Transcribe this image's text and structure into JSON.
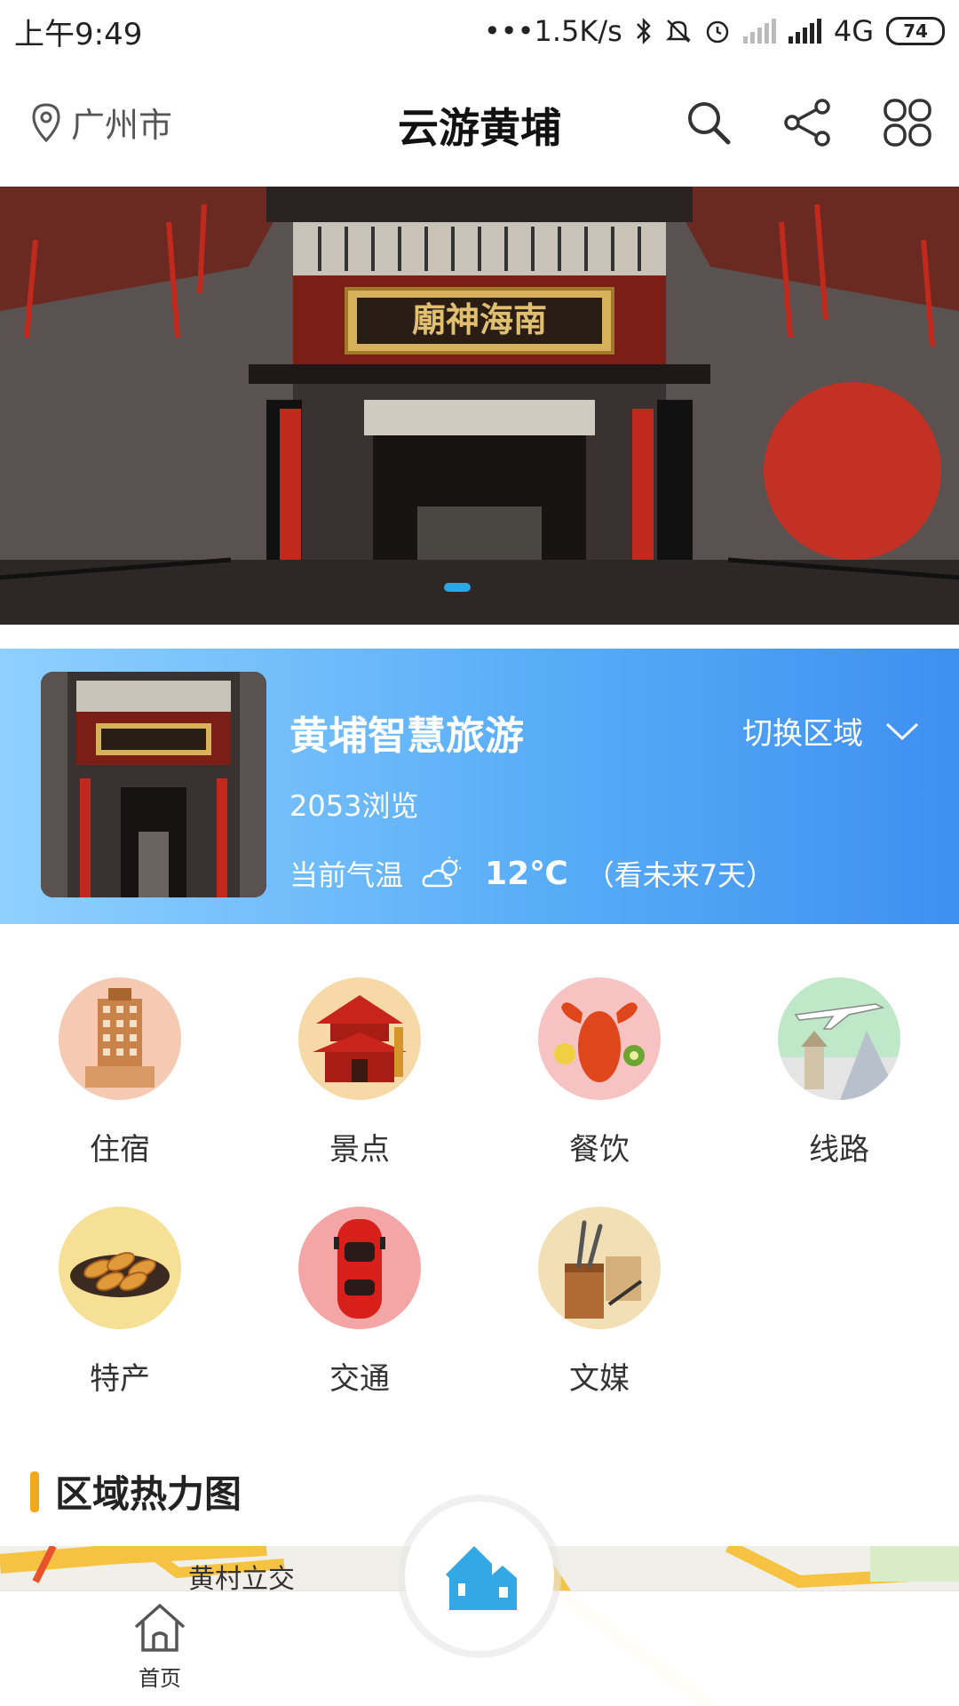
{
  "status_bar": {
    "time": "上午9:49",
    "speed": "•••1.5K/s",
    "network": "4G",
    "battery": "74"
  },
  "header": {
    "location": "广州市",
    "title": "云游黄埔"
  },
  "banner": {
    "sign_text": "廟神海南"
  },
  "info_card": {
    "name": "黄埔智慧旅游",
    "switch_label": "切换区域",
    "views": "2053浏览",
    "temp_label": "当前气温",
    "temperature": "12℃",
    "forecast": "（看未来7天）"
  },
  "categories": [
    {
      "label": "住宿",
      "icon": "hotel-building-icon"
    },
    {
      "label": "景点",
      "icon": "pagoda-temple-icon"
    },
    {
      "label": "餐饮",
      "icon": "lobster-food-icon"
    },
    {
      "label": "线路",
      "icon": "airplane-route-icon"
    },
    {
      "label": "特产",
      "icon": "snack-specialty-icon"
    },
    {
      "label": "交通",
      "icon": "red-car-icon"
    },
    {
      "label": "文媒",
      "icon": "brush-media-icon"
    }
  ],
  "heatmap": {
    "title": "区域热力图",
    "place_label": "黄村立交"
  },
  "bottom_nav": {
    "home_label": "首页"
  },
  "colors": {
    "accent_blue": "#4a9ff2",
    "section_bar": "#f2a91e",
    "banner_dot": "#29a7e6"
  }
}
